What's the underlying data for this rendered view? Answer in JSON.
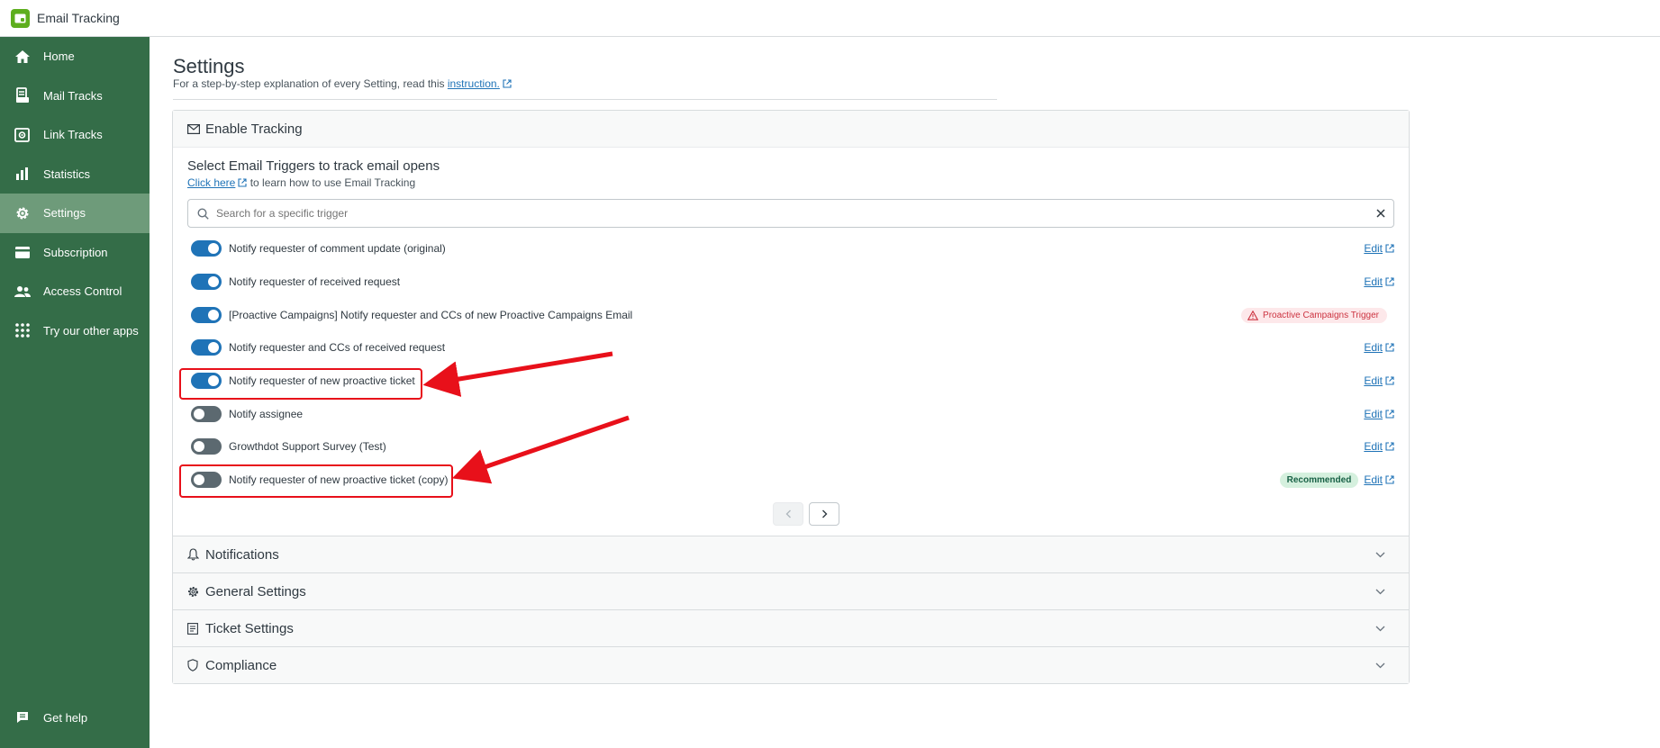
{
  "app": {
    "title": "Email Tracking"
  },
  "sidebar": {
    "items": [
      {
        "label": "Home",
        "icon": "home-icon"
      },
      {
        "label": "Mail Tracks",
        "icon": "mail-tracks-icon"
      },
      {
        "label": "Link Tracks",
        "icon": "link-tracks-icon"
      },
      {
        "label": "Statistics",
        "icon": "bar-chart-icon"
      },
      {
        "label": "Settings",
        "icon": "gear-icon",
        "active": true
      },
      {
        "label": "Subscription",
        "icon": "credit-card-icon"
      },
      {
        "label": "Access Control",
        "icon": "users-icon"
      },
      {
        "label": "Try our other apps",
        "icon": "grid-icon"
      }
    ],
    "help_label": "Get help"
  },
  "page": {
    "title": "Settings",
    "subtitle": "For a step-by-step explanation of every Setting, read this",
    "subtitle_link": "instruction."
  },
  "enable_tracking": {
    "header": "Enable Tracking",
    "section_title": "Select Email Triggers to track email opens",
    "click_here": "Click here",
    "click_here_suffix": "to learn how to use Email Tracking",
    "search_placeholder": "Search for a specific trigger",
    "edit_label": "Edit",
    "triggers": [
      {
        "label": "Notify requester of comment update (original)",
        "enabled": true
      },
      {
        "label": "Notify requester of received request",
        "enabled": true
      },
      {
        "label": "[Proactive Campaigns] Notify requester and CCs of new Proactive Campaigns Email",
        "enabled": true,
        "badge": "Proactive Campaigns Trigger"
      },
      {
        "label": "Notify requester and CCs of received request",
        "enabled": true
      },
      {
        "label": "Notify requester of new proactive ticket",
        "enabled": true
      },
      {
        "label": "Notify assignee",
        "enabled": false
      },
      {
        "label": "Growthdot Support Survey (Test)",
        "enabled": false
      },
      {
        "label": "Notify requester of new proactive ticket (copy)",
        "enabled": false,
        "badge": "Recommended"
      }
    ]
  },
  "sections": [
    {
      "label": "Notifications",
      "icon": "bell-icon"
    },
    {
      "label": "General Settings",
      "icon": "gear-icon"
    },
    {
      "label": "Ticket Settings",
      "icon": "ticket-icon"
    },
    {
      "label": "Compliance",
      "icon": "shield-icon"
    }
  ],
  "colors": {
    "sidebar": "#346d48",
    "sidebar_active": "#6e9b7a",
    "accent": "#1f73b7",
    "annotation": "#e8101a"
  }
}
